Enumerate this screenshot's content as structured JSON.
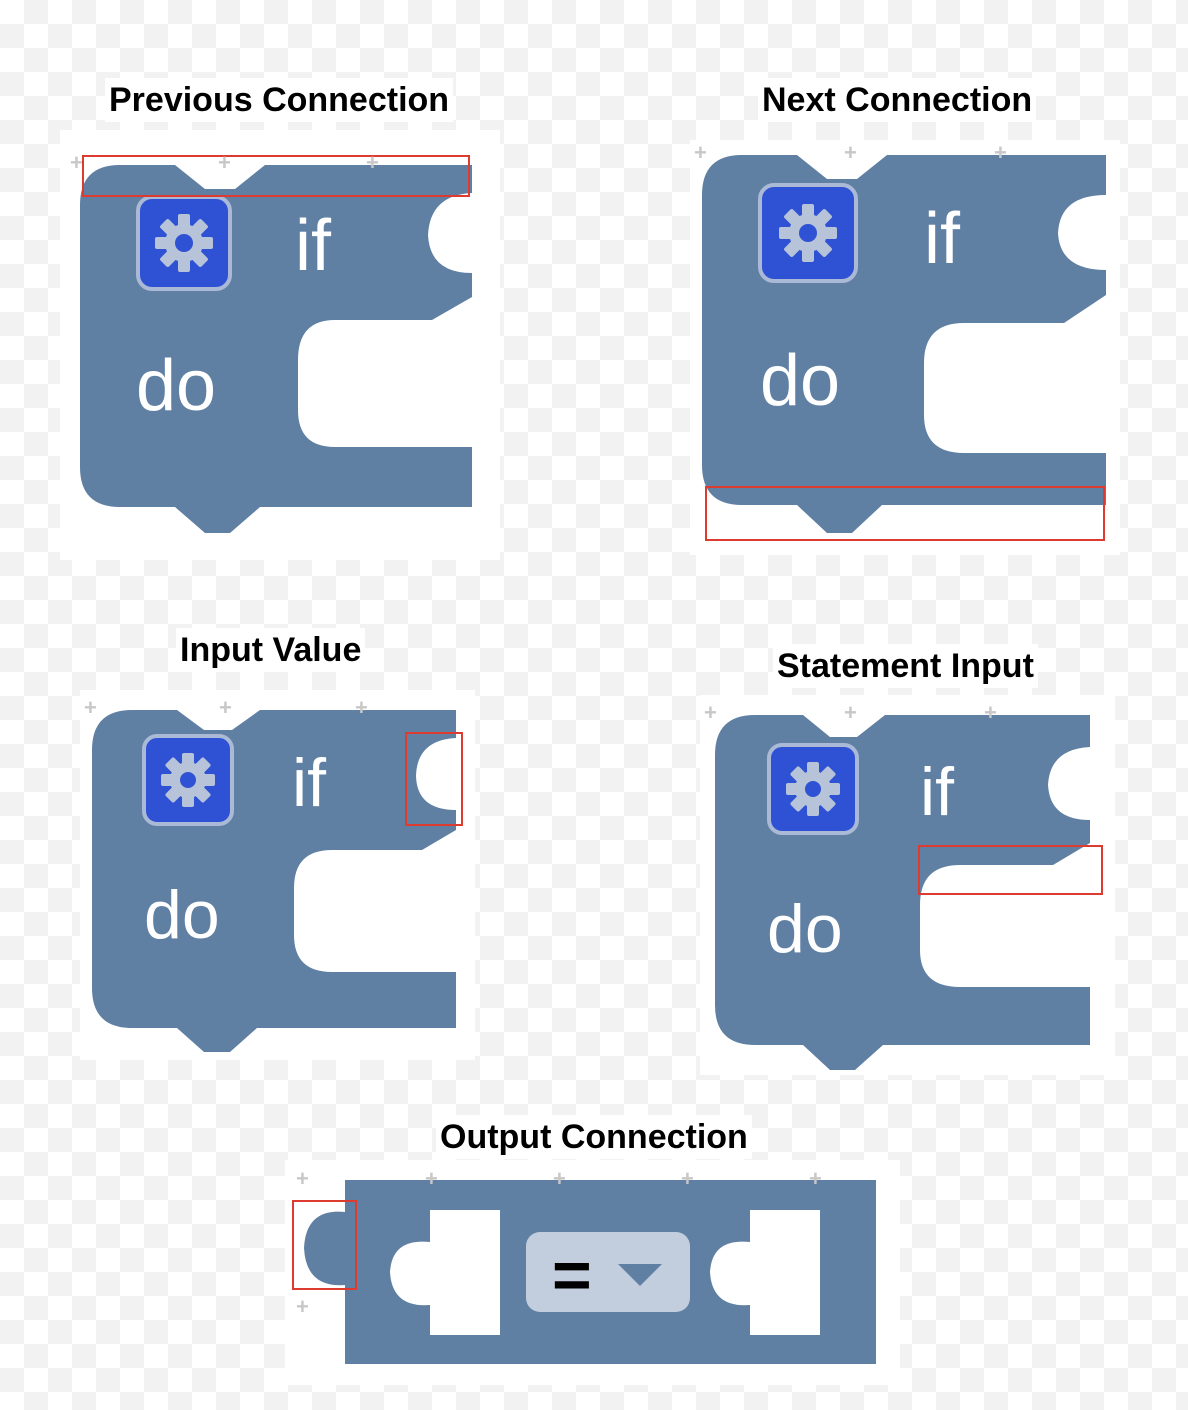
{
  "panels": [
    {
      "id": "previous",
      "title": "Previous Connection",
      "if_label": "if",
      "do_label": "do"
    },
    {
      "id": "next",
      "title": "Next Connection",
      "if_label": "if",
      "do_label": "do"
    },
    {
      "id": "input_value",
      "title": "Input Value",
      "if_label": "if",
      "do_label": "do"
    },
    {
      "id": "statement",
      "title": "Statement Input",
      "if_label": "if",
      "do_label": "do"
    }
  ],
  "output": {
    "title": "Output Connection",
    "operator": "="
  },
  "colors": {
    "block": "#5f7fa3",
    "block_shadow": "#4d6a8c",
    "gear_bg": "#2f51d4",
    "gear_border": "#a9b9d6",
    "gear_fg": "#b6c3d8",
    "highlight": "#dd3b2f",
    "dropdown_bg": "#c2cede"
  },
  "icons": {
    "mutator": "gear-icon",
    "dropdown": "triangle-down-icon"
  }
}
